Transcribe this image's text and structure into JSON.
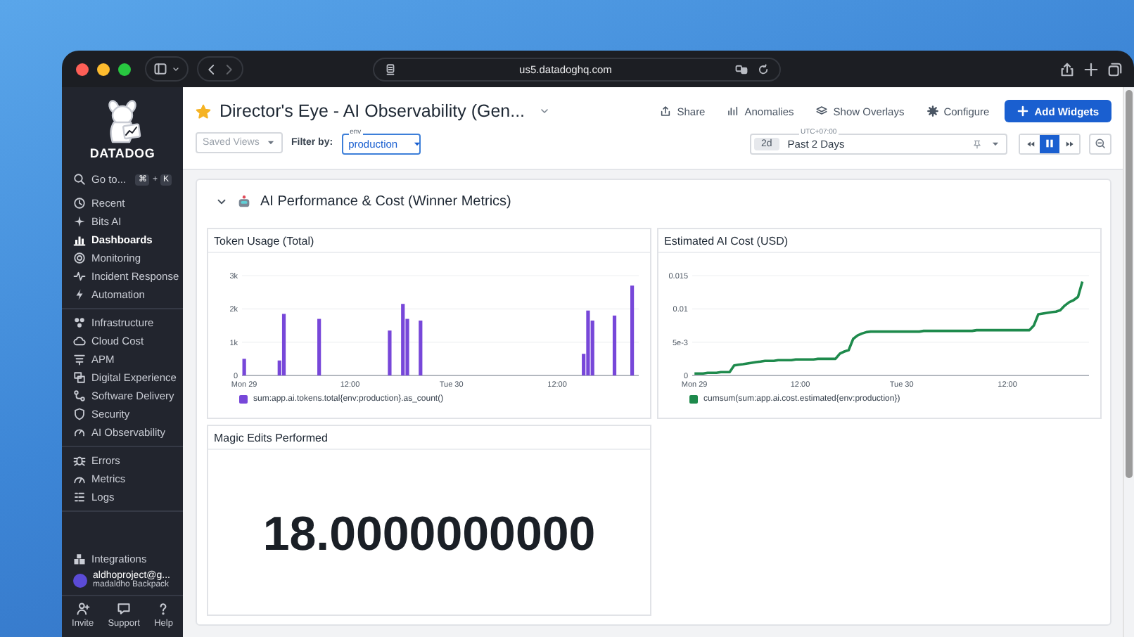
{
  "browser": {
    "url": "us5.datadoghq.com"
  },
  "sidebar": {
    "logo_text": "DATADOG",
    "search": {
      "label": "Go to...",
      "keys": [
        "⌘",
        "K"
      ],
      "joiner": "+"
    },
    "sections": [
      [
        {
          "label": "Recent",
          "selected": false
        },
        {
          "label": "Bits AI",
          "selected": false
        },
        {
          "label": "Dashboards",
          "selected": true
        },
        {
          "label": "Monitoring",
          "selected": false
        },
        {
          "label": "Incident Response",
          "selected": false
        },
        {
          "label": "Automation",
          "selected": false
        }
      ],
      [
        {
          "label": "Infrastructure",
          "selected": false
        },
        {
          "label": "Cloud Cost",
          "selected": false
        },
        {
          "label": "APM",
          "selected": false
        },
        {
          "label": "Digital Experience",
          "selected": false
        },
        {
          "label": "Software Delivery",
          "selected": false
        },
        {
          "label": "Security",
          "selected": false
        },
        {
          "label": "AI Observability",
          "selected": false
        }
      ],
      [
        {
          "label": "Errors",
          "selected": false
        },
        {
          "label": "Metrics",
          "selected": false
        },
        {
          "label": "Logs",
          "selected": false
        }
      ]
    ],
    "integrations": "Integrations",
    "account": {
      "email": "aldhoproject@g...",
      "org": "madaldho Backpack"
    },
    "footer": [
      "Invite",
      "Support",
      "Help"
    ]
  },
  "header": {
    "favorite": true,
    "title": "Director's Eye - AI Observability (Gen...",
    "actions": [
      {
        "label": "Share",
        "kind": "plain"
      },
      {
        "label": "Anomalies",
        "kind": "plain"
      },
      {
        "label": "Show Overlays",
        "kind": "plain"
      },
      {
        "label": "Configure",
        "kind": "plain"
      },
      {
        "label": "Add Widgets",
        "kind": "primary"
      }
    ],
    "saved_views": {
      "placeholder": "Saved Views"
    },
    "filter_label": "Filter by:",
    "env": {
      "label": "env",
      "value": "production"
    },
    "time": {
      "timezone": "UTC+07:00",
      "badge": "2d",
      "value": "Past 2 Days",
      "live": true
    }
  },
  "group": {
    "title": "AI Performance & Cost (Winner Metrics)",
    "expanded": true,
    "widgets": [
      {
        "kind": "timeseries",
        "title": "Token Usage (Total)",
        "chart_data": {
          "type": "bar",
          "ylim": [
            0,
            3000
          ],
          "grid": true,
          "categories": [
            "Mon 29",
            null,
            null,
            null,
            null,
            null,
            null,
            null,
            null,
            null,
            null,
            null,
            null,
            null,
            null,
            null,
            null,
            null,
            null,
            null,
            null,
            null,
            null,
            null,
            "12:00",
            null,
            null,
            null,
            null,
            null,
            null,
            null,
            null,
            null,
            null,
            null,
            null,
            null,
            null,
            null,
            null,
            null,
            null,
            null,
            null,
            null,
            null,
            "Tue 30",
            null,
            null,
            null,
            null,
            null,
            null,
            null,
            null,
            null,
            null,
            null,
            null,
            null,
            null,
            null,
            null,
            null,
            null,
            null,
            null,
            null,
            null,
            null,
            "12:00",
            null,
            null,
            null,
            null,
            null,
            null,
            null,
            null,
            null,
            null,
            null,
            null,
            null,
            null,
            null,
            null,
            null,
            null
          ],
          "yticks": [
            {
              "value": 0,
              "label": "0"
            },
            {
              "value": 1000,
              "label": "1k"
            },
            {
              "value": 2000,
              "label": "2k"
            },
            {
              "value": 3000,
              "label": "3k"
            }
          ],
          "series": [
            {
              "name": "sum:app.ai.tokens.total{env:production}.as_count()",
              "color": "#7747d9",
              "values": [
                500,
                null,
                null,
                null,
                null,
                null,
                null,
                null,
                450,
                1850,
                null,
                null,
                null,
                null,
                null,
                null,
                null,
                1700,
                null,
                null,
                null,
                null,
                null,
                null,
                null,
                null,
                null,
                null,
                null,
                null,
                null,
                null,
                null,
                1350,
                null,
                null,
                2150,
                1700,
                null,
                null,
                1650,
                null,
                null,
                null,
                null,
                null,
                null,
                null,
                null,
                null,
                null,
                null,
                null,
                null,
                null,
                null,
                null,
                null,
                null,
                null,
                null,
                null,
                null,
                null,
                null,
                null,
                null,
                null,
                null,
                null,
                null,
                null,
                null,
                null,
                null,
                null,
                null,
                650,
                1950,
                1650,
                null,
                null,
                null,
                null,
                1800,
                null,
                null,
                null,
                2700,
                null
              ]
            }
          ]
        }
      },
      {
        "kind": "timeseries",
        "title": "Estimated AI Cost (USD)",
        "chart_data": {
          "type": "line",
          "ylim": [
            0,
            0.015
          ],
          "grid": true,
          "categories": [
            "Mon 29",
            null,
            null,
            null,
            null,
            null,
            null,
            null,
            null,
            null,
            null,
            null,
            null,
            null,
            null,
            null,
            null,
            null,
            null,
            null,
            null,
            null,
            null,
            null,
            "12:00",
            null,
            null,
            null,
            null,
            null,
            null,
            null,
            null,
            null,
            null,
            null,
            null,
            null,
            null,
            null,
            null,
            null,
            null,
            null,
            null,
            null,
            null,
            "Tue 30",
            null,
            null,
            null,
            null,
            null,
            null,
            null,
            null,
            null,
            null,
            null,
            null,
            null,
            null,
            null,
            null,
            null,
            null,
            null,
            null,
            null,
            null,
            null,
            "12:00",
            null,
            null,
            null,
            null,
            null,
            null,
            null,
            null,
            null,
            null,
            null,
            null,
            null,
            null,
            null,
            null,
            null,
            null
          ],
          "yticks": [
            {
              "value": 0,
              "label": "0"
            },
            {
              "value": 0.005,
              "label": "5e-3"
            },
            {
              "value": 0.01,
              "label": "0.01"
            },
            {
              "value": 0.015,
              "label": "0.015"
            }
          ],
          "series": [
            {
              "name": "cumsum(sum:app.ai.cost.estimated{env:production})",
              "color": "#1e8a4c",
              "values": [
                0.0003,
                0.0003,
                0.0003,
                0.0004,
                0.0004,
                0.0004,
                0.0005,
                0.0005,
                0.0005,
                0.0015,
                0.0016,
                0.0017,
                0.0018,
                0.0019,
                0.002,
                0.0021,
                0.0022,
                0.0022,
                0.0022,
                0.0023,
                0.0023,
                0.0023,
                0.0023,
                0.0024,
                0.0024,
                0.0024,
                0.0024,
                0.0024,
                0.0025,
                0.0025,
                0.0025,
                0.0025,
                0.0025,
                0.0033,
                0.0036,
                0.0038,
                0.0055,
                0.006,
                0.0063,
                0.0065,
                0.0066,
                0.0066,
                0.0066,
                0.0066,
                0.0066,
                0.0066,
                0.0066,
                0.0066,
                0.0066,
                0.0066,
                0.0066,
                0.0066,
                0.0067,
                0.0067,
                0.0067,
                0.0067,
                0.0067,
                0.0067,
                0.0067,
                0.0067,
                0.0067,
                0.0067,
                0.0067,
                0.0067,
                0.0068,
                0.0068,
                0.0068,
                0.0068,
                0.0068,
                0.0068,
                0.0068,
                0.0068,
                0.0068,
                0.0068,
                0.0068,
                0.0068,
                0.0068,
                0.0075,
                0.0092,
                0.0093,
                0.0094,
                0.0095,
                0.0096,
                0.0098,
                0.0105,
                0.011,
                0.0113,
                0.0118,
                0.0141,
                null
              ]
            }
          ]
        }
      },
      {
        "kind": "query_value",
        "title": "Magic Edits Performed",
        "value": "18.0000000000"
      }
    ]
  }
}
